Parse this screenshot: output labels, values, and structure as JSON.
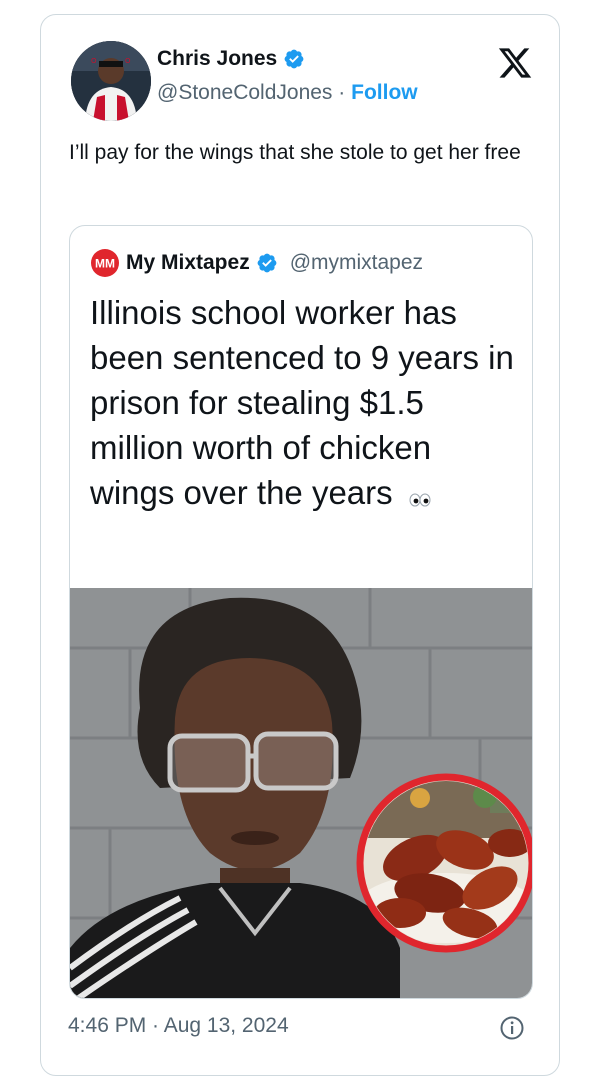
{
  "tweet": {
    "author_name": "Chris Jones",
    "author_handle": "@StoneColdJones",
    "separator": "·",
    "follow_label": "Follow",
    "text": "I’ll pay for the wings that she stole to get her free",
    "timestamp": "4:46 PM · Aug 13, 2024"
  },
  "quote": {
    "author_name": "My Mixtapez",
    "author_handle": "@mymixtapez",
    "logo_text": "MM",
    "text": "Illinois school worker has been sentenced to 9 years in prison for stealing $1.5 million worth of chicken wings over the years"
  },
  "icons": {
    "verified": "verified-badge-icon",
    "x_logo": "x-logo-icon",
    "eyes": "eyes-emoji-icon",
    "info": "info-icon"
  },
  "colors": {
    "accent": "#1d9bf0",
    "text": "#0f1419",
    "muted": "#536471",
    "border": "#cfd9de",
    "mm_red": "#e0262d"
  }
}
